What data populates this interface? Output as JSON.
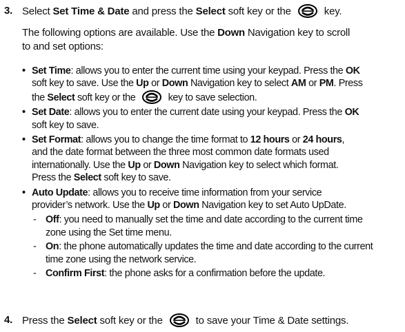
{
  "step3": {
    "number": "3.",
    "pre": "Select ",
    "bold1": "Set Time & Date",
    "mid": " and press the ",
    "bold2": "Select",
    "mid2": " soft key or the ",
    "post": " key."
  },
  "intro": {
    "l1a": "The following options are available. Use the ",
    "l1b": "Down",
    "l1c": " Navigation key to scroll",
    "l2": "to and set options:"
  },
  "options": {
    "set_time": {
      "title": "Set Time",
      "l1a": ": allows you to enter the current time using your keypad. Press the ",
      "l1b": "OK",
      "l2a": "soft key to save. Use the ",
      "l2b": "Up",
      "l2c": " or ",
      "l2d": "Down",
      "l2e": " Navigation key to select ",
      "l2f": "AM",
      "l2g": " or ",
      "l2h": "PM",
      "l2i": ". Press",
      "l3a": "the ",
      "l3b": "Select",
      "l3c": " soft key or the ",
      "l3d": " key to save selection."
    },
    "set_date": {
      "title": "Set Date",
      "l1a": ": allows you to enter the current date using your keypad. Press the ",
      "l1b": "OK",
      "l2": "soft key to save."
    },
    "set_format": {
      "title": "Set Format",
      "l1a": ": allows you to change the time format to ",
      "l1b": "12 hours",
      "l1c": " or ",
      "l1d": "24 hours",
      "l1e": ",",
      "l2": "and the date format between the three most common date formats used",
      "l3a": "internationally. Use the ",
      "l3b": "Up",
      "l3c": " or ",
      "l3d": "Down",
      "l3e": " Navigation key to select which format.",
      "l4a": "Press the ",
      "l4b": "Select",
      "l4c": " soft key to save."
    },
    "auto_update": {
      "title": "Auto Update",
      "l1a": ": allows you to receive time information from your service",
      "l2a": "provider’s network. Use the ",
      "l2b": "Up",
      "l2c": " or ",
      "l2d": "Down",
      "l2e": " Navigation key to set Auto UpDate.",
      "subs": {
        "off": {
          "title": "Off",
          "l1": ": you need to manually set the time and date according to the current time",
          "l2": "zone using the Set time menu."
        },
        "on": {
          "title": "On",
          "l1": ": the phone automatically updates the time and date according to the current",
          "l2": "time zone using the network service."
        },
        "confirm": {
          "title": "Confirm First",
          "l1": ": the phone asks for a confirmation before the update."
        }
      }
    }
  },
  "step4": {
    "number": "4.",
    "pre": "Press the ",
    "bold1": "Select",
    "mid": " soft key or the ",
    "post": " to save your Time & Date settings."
  },
  "icons": [
    "select-key-icon"
  ],
  "bullet_glyph": "•",
  "dash_glyph": "-"
}
